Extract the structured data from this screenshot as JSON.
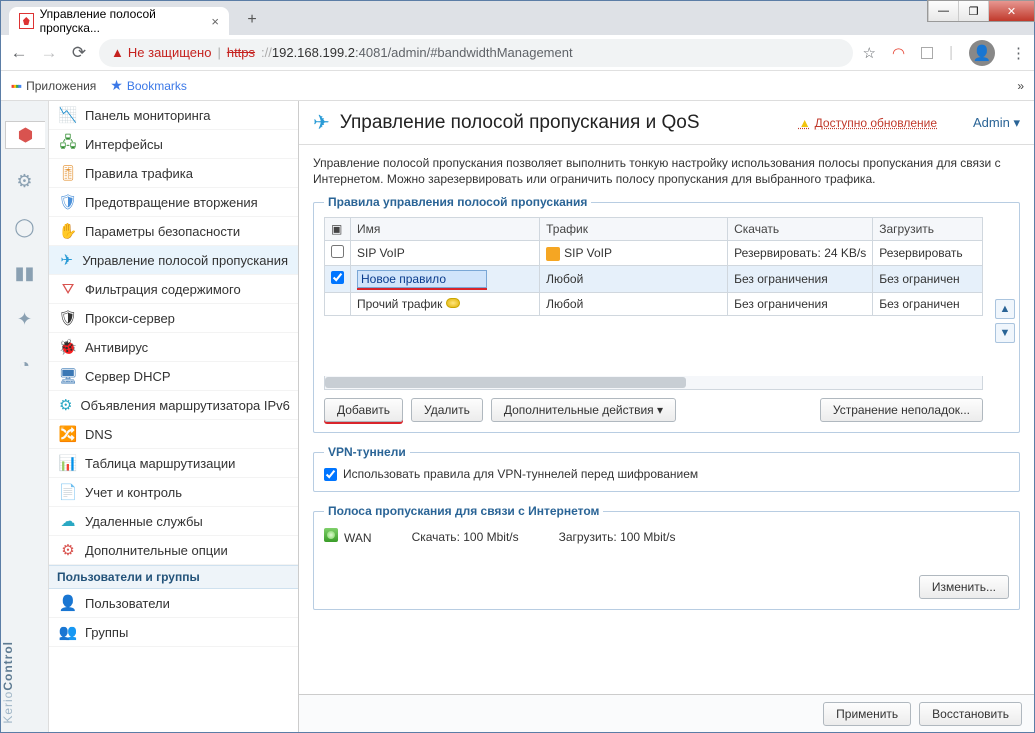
{
  "window": {
    "minimize": "—",
    "maximize": "❐",
    "close": "✕"
  },
  "browser": {
    "tab_title": "Управление полосой пропуска...",
    "newtab": "+",
    "nav": {
      "back": "←",
      "forward": "→",
      "reload": "⟳"
    },
    "insecure_label": "Не защищено",
    "https_label": "https",
    "url_host": "192.168.199.2",
    "url_port": ":4081",
    "url_path": "/admin/#bandwidthManagement",
    "apps_label": "Приложения",
    "bookmarks_label": "Bookmarks",
    "overflow": "»"
  },
  "leftrail": {
    "brand_a": "Kerio",
    "brand_b": "Control"
  },
  "sidebar": {
    "items": [
      {
        "icon": "📉",
        "label": "Панель мониторинга",
        "color": "#777"
      },
      {
        "icon": "🖧",
        "label": "Интерфейсы",
        "color": "#2e8b2e"
      },
      {
        "icon": "🎚",
        "label": "Правила трафика",
        "color": "#e0871e"
      },
      {
        "icon": "🛡",
        "label": "Предотвращение вторжения",
        "color": "#4a90d9"
      },
      {
        "icon": "✋",
        "label": "Параметры безопасности",
        "color": "#d9534f"
      },
      {
        "icon": "✈",
        "label": "Управление полосой пропускания",
        "color": "#2a9bd6",
        "active": true
      },
      {
        "icon": "⛛",
        "label": "Фильтрация содержимого",
        "color": "#d9534f"
      },
      {
        "icon": "🛡",
        "label": "Прокси-сервер",
        "color": "#333"
      },
      {
        "icon": "🐞",
        "label": "Антивирус",
        "color": "#46a35e"
      },
      {
        "icon": "🖥",
        "label": "Сервер DHCP",
        "color": "#3b78b5"
      },
      {
        "icon": "⚙",
        "label": "Объявления маршрутизатора IPv6",
        "color": "#2aa8c3"
      },
      {
        "icon": "🔀",
        "label": "DNS",
        "color": "#3b78b5"
      },
      {
        "icon": "📊",
        "label": "Таблица маршрутизации",
        "color": "#d9534f"
      },
      {
        "icon": "📄",
        "label": "Учет и контроль",
        "color": "#f0ad4e"
      },
      {
        "icon": "☁",
        "label": "Удаленные службы",
        "color": "#2aa8c3"
      },
      {
        "icon": "⚙",
        "label": "Дополнительные опции",
        "color": "#d9534f"
      }
    ],
    "group_header": "Пользователи и группы",
    "users": {
      "icon": "👤",
      "label": "Пользователи",
      "color": "#4a90d9"
    },
    "groups": {
      "icon": "👥",
      "label": "Группы",
      "color": "#4a90d9"
    }
  },
  "page": {
    "title": "Управление полосой пропускания и QoS",
    "update": "Доступно обновление",
    "admin": "Admin ▾",
    "desc": "Управление полосой пропускания позволяет выполнить тонкую настройку использования полосы пропускания для связи с Интернетом. Можно зарезервировать или ограничить полосу пропускания для выбранного трафика."
  },
  "rules": {
    "legend": "Правила управления полосой пропускания",
    "cols": {
      "name": "Имя",
      "traffic": "Трафик",
      "download": "Скачать",
      "upload": "Загрузить"
    },
    "rows": [
      {
        "checked": false,
        "name": "SIP VoIP",
        "traffic": "SIP VoIP",
        "traffic_badge": true,
        "download": "Резервировать: 24 KB/s",
        "upload": "Резервировать"
      },
      {
        "checked": true,
        "selected": true,
        "editing": true,
        "name": "Новое правило",
        "traffic": "Любой",
        "download": "Без ограничения",
        "upload": "Без ограничен"
      },
      {
        "checked": null,
        "name": "Прочий трафик",
        "lamp": true,
        "traffic": "Любой",
        "download": "Без ограничения",
        "upload": "Без ограничен"
      }
    ],
    "buttons": {
      "add": "Добавить",
      "del": "Удалить",
      "more": "Дополнительные действия ▾",
      "trouble": "Устранение неполадок..."
    }
  },
  "vpn": {
    "legend": "VPN-туннели",
    "checkbox_label": "Использовать правила для VPN-туннелей перед шифрованием"
  },
  "internet": {
    "legend": "Полоса пропускания для связи с Интернетом",
    "iface": "WAN",
    "dl_label": "Скачать:",
    "dl_val": "100 Mbit/s",
    "ul_label": "Загрузить:",
    "ul_val": "100 Mbit/s",
    "change": "Изменить..."
  },
  "footer": {
    "apply": "Применить",
    "restore": "Восстановить"
  }
}
